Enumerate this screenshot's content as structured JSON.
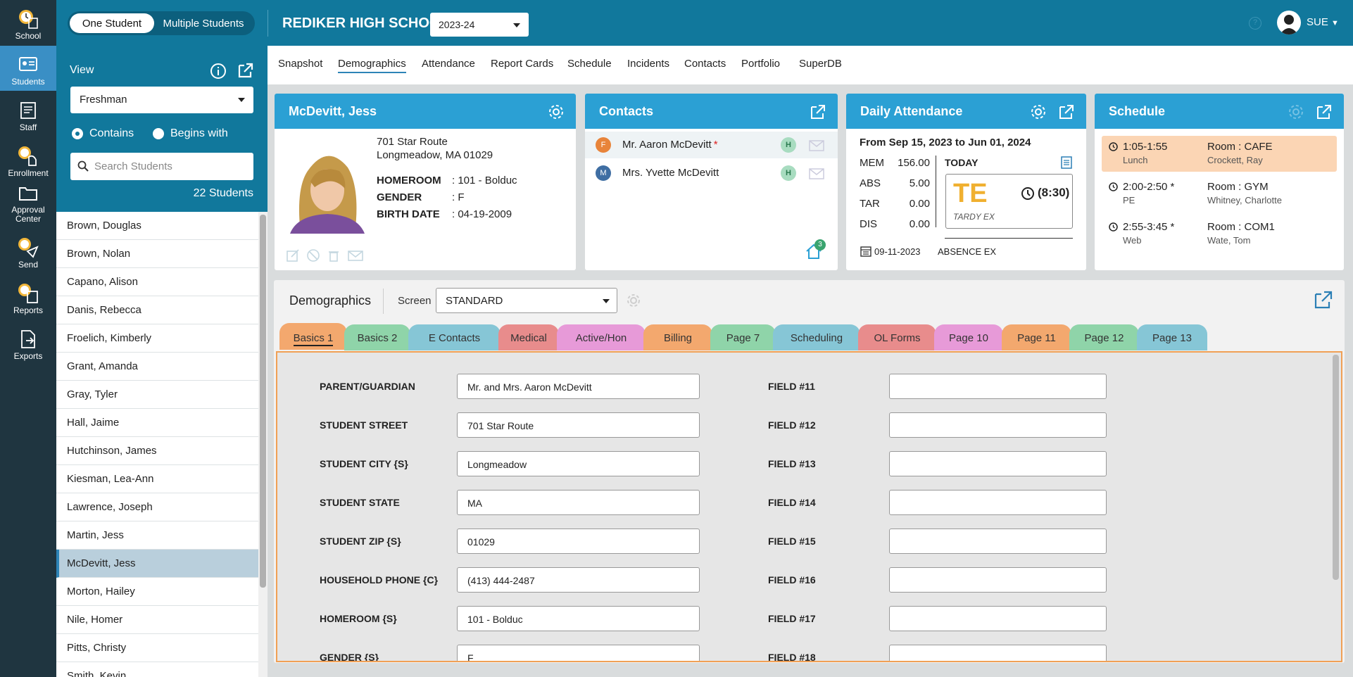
{
  "nav": [
    {
      "label": "School",
      "icon": "clock-building-icon"
    },
    {
      "label": "Students",
      "icon": "id-card-icon"
    },
    {
      "label": "Staff",
      "icon": "staff-clipboard-icon"
    },
    {
      "label": "Enrollment",
      "icon": "enrollment-icon"
    },
    {
      "label": "Approval Center",
      "icon": "folder-icon"
    },
    {
      "label": "Send",
      "icon": "send-icon"
    },
    {
      "label": "Reports",
      "icon": "reports-icon"
    },
    {
      "label": "Exports",
      "icon": "export-file-icon"
    }
  ],
  "header": {
    "mode_one": "One Student",
    "mode_multi": "Multiple Students",
    "school": "REDIKER HIGH SCHOOL",
    "year": "2023-24",
    "user": "SUE",
    "help": "?"
  },
  "side": {
    "view_label": "View",
    "view_value": "Freshman",
    "contains": "Contains",
    "begins": "Begins with",
    "search_placeholder": "Search Students",
    "count": "22 Students"
  },
  "students": [
    "Brown, Douglas",
    "Brown, Nolan",
    "Capano, Alison",
    "Danis, Rebecca",
    "Froelich, Kimberly",
    "Grant, Amanda",
    "Gray, Tyler",
    "Hall, Jaime",
    "Hutchinson, James",
    "Kiesman, Lea-Ann",
    "Lawrence, Joseph",
    "Martin, Jess",
    "McDevitt, Jess",
    "Morton, Hailey",
    "Nile, Homer",
    "Pitts, Christy",
    "Smith, Kevin"
  ],
  "tabs": [
    "Snapshot",
    "Demographics",
    "Attendance",
    "Report Cards",
    "Schedule",
    "Incidents",
    "Contacts",
    "Portfolio",
    "SuperDB"
  ],
  "student": {
    "name": "McDevitt, Jess",
    "street": "701 Star Route",
    "city": "Longmeadow, MA 01029",
    "homeroom_lbl": "HOMEROOM",
    "homeroom": ": 101 - Bolduc",
    "gender_lbl": "GENDER",
    "gender": ": F",
    "birth_lbl": "BIRTH DATE",
    "birth": ": 04-19-2009"
  },
  "contacts": {
    "title": "Contacts",
    "items": [
      {
        "initial": "F",
        "name": "Mr. Aaron McDevitt",
        "star": "*",
        "tag": "H",
        "color": "#e8843a"
      },
      {
        "initial": "M",
        "name": "Mrs. Yvette McDevitt",
        "star": "",
        "tag": "H",
        "color": "#3f6ea3"
      }
    ],
    "home_count": "3"
  },
  "attendance": {
    "title": "Daily Attendance",
    "range": "From Sep 15, 2023 to Jun 01, 2024",
    "rows": [
      {
        "k": "MEM",
        "v": "156.00"
      },
      {
        "k": "ABS",
        "v": "5.00"
      },
      {
        "k": "TAR",
        "v": "0.00"
      },
      {
        "k": "DIS",
        "v": "0.00"
      }
    ],
    "today": "TODAY",
    "code": "TE",
    "time": "(8:30)",
    "code_desc": "TARDY EX",
    "date": "09-11-2023",
    "date_desc": "ABSENCE EX"
  },
  "schedule": {
    "title": "Schedule",
    "items": [
      {
        "time": "1:05-1:55",
        "course": "Lunch",
        "room": "Room : CAFE",
        "teacher": "Crockett, Ray"
      },
      {
        "time": "2:00-2:50 *",
        "course": "PE",
        "room": "Room : GYM",
        "teacher": "Whitney, Charlotte"
      },
      {
        "time": "2:55-3:45 *",
        "course": "Web",
        "room": "Room : COM1",
        "teacher": "Wate, Tom"
      }
    ]
  },
  "demographics": {
    "title": "Demographics",
    "screen_label": "Screen",
    "screen_value": "STANDARD"
  },
  "btabs": [
    {
      "label": "Basics 1",
      "color": "#f3a86e"
    },
    {
      "label": "Basics 2",
      "color": "#8fd4a9"
    },
    {
      "label": "E Contacts",
      "color": "#86c6d6"
    },
    {
      "label": "Medical",
      "color": "#e88c8c"
    },
    {
      "label": "Active/Hon",
      "color": "#e79ad8"
    },
    {
      "label": "Billing",
      "color": "#f3a86e"
    },
    {
      "label": "Page 7",
      "color": "#8fd4a9"
    },
    {
      "label": "Scheduling",
      "color": "#86c6d6"
    },
    {
      "label": "OL Forms",
      "color": "#e88c8c"
    },
    {
      "label": "Page 10",
      "color": "#e79ad8"
    },
    {
      "label": "Page 11",
      "color": "#f3a86e"
    },
    {
      "label": "Page 12",
      "color": "#8fd4a9"
    },
    {
      "label": "Page 13",
      "color": "#86c6d6"
    }
  ],
  "fields_left": [
    {
      "label": "PARENT/GUARDIAN",
      "value": "Mr. and Mrs. Aaron McDevitt"
    },
    {
      "label": "STUDENT STREET",
      "value": "701 Star Route"
    },
    {
      "label": "STUDENT CITY {S}",
      "value": "Longmeadow"
    },
    {
      "label": "STUDENT STATE",
      "value": "MA"
    },
    {
      "label": "STUDENT ZIP {S}",
      "value": "01029"
    },
    {
      "label": "HOUSEHOLD PHONE {C}",
      "value": "(413) 444-2487"
    },
    {
      "label": "HOMEROOM {S}",
      "value": "101 - Bolduc"
    },
    {
      "label": "GENDER {S}",
      "value": "F"
    }
  ],
  "fields_right": [
    {
      "label": "FIELD #11",
      "value": ""
    },
    {
      "label": "FIELD #12",
      "value": ""
    },
    {
      "label": "FIELD #13",
      "value": ""
    },
    {
      "label": "FIELD #14",
      "value": ""
    },
    {
      "label": "FIELD #15",
      "value": ""
    },
    {
      "label": "FIELD #16",
      "value": ""
    },
    {
      "label": "FIELD #17",
      "value": ""
    },
    {
      "label": "FIELD #18",
      "value": ""
    }
  ]
}
